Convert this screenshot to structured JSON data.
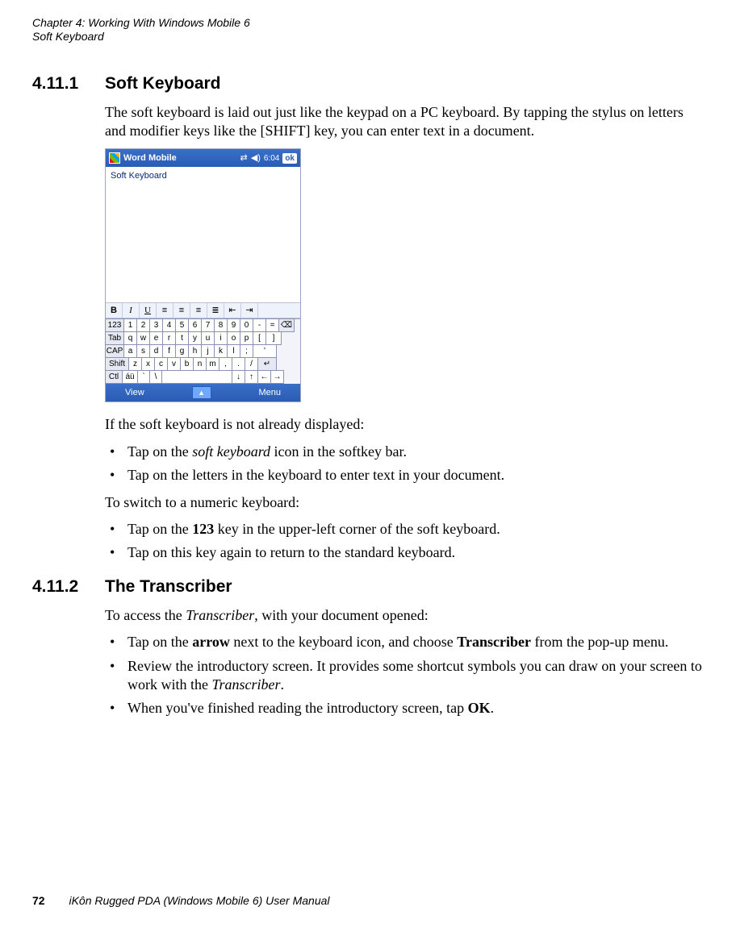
{
  "header": {
    "chapter": "Chapter 4:  Working With Windows Mobile 6",
    "section": "Soft Keyboard"
  },
  "s1": {
    "num": "4.11.1",
    "title": "Soft Keyboard",
    "p1a": "The soft keyboard is laid out just like the keypad on a PC keyboard. By tapping the stylus on letters and modifier keys like the [SHIFT] key, you can enter text in a document.",
    "p2": "If the soft keyboard is not already displayed:",
    "b1a": "Tap on the ",
    "b1b": "soft keyboard",
    "b1c": " icon in the softkey bar.",
    "b2": "Tap on the letters in the keyboard to enter text in your document.",
    "p3": "To switch to a numeric keyboard:",
    "b3a": "Tap on the ",
    "b3b": "123",
    "b3c": " key in the upper-left corner of the soft keyboard.",
    "b4": "Tap on this key again to return to the standard keyboard."
  },
  "s2": {
    "num": "4.11.2",
    "title": "The Transcriber",
    "p1a": "To access the ",
    "p1b": "Transcriber",
    "p1c": ", with your document opened:",
    "b1a": "Tap on the ",
    "b1b": "arrow",
    "b1c": " next to the keyboard icon, and choose ",
    "b1d": "Transcriber",
    "b1e": " from the pop-up menu.",
    "b2a": "Review the introductory screen. It provides some shortcut symbols you can draw on your screen to work with the ",
    "b2b": "Transcriber",
    "b2c": ".",
    "b3a": "When you've finished reading the introductory screen, tap ",
    "b3b": "OK",
    "b3c": "."
  },
  "fig": {
    "app": "Word Mobile",
    "time": "6:04",
    "ok": "ok",
    "doc_text": "Soft Keyboard",
    "fmt": {
      "b": "B",
      "i": "I",
      "u": "U"
    },
    "row1": [
      "123",
      "1",
      "2",
      "3",
      "4",
      "5",
      "6",
      "7",
      "8",
      "9",
      "0",
      "-",
      "=",
      "⌫"
    ],
    "row2": [
      "Tab",
      "q",
      "w",
      "e",
      "r",
      "t",
      "y",
      "u",
      "i",
      "o",
      "p",
      "[",
      "]"
    ],
    "row3": [
      "CAP",
      "a",
      "s",
      "d",
      "f",
      "g",
      "h",
      "j",
      "k",
      "l",
      ";",
      "'"
    ],
    "row4": [
      "Shift",
      "z",
      "x",
      "c",
      "v",
      "b",
      "n",
      "m",
      ",",
      ".",
      "/",
      "↵"
    ],
    "row5": [
      "Ctl",
      "áü",
      "`",
      "\\",
      " ",
      "↓",
      "↑",
      "←",
      "→"
    ],
    "soft_left": "View",
    "soft_right": "Menu",
    "soft_center": "▲"
  },
  "footer": {
    "page": "72",
    "book": "iKôn Rugged PDA (Windows Mobile 6) User Manual"
  }
}
